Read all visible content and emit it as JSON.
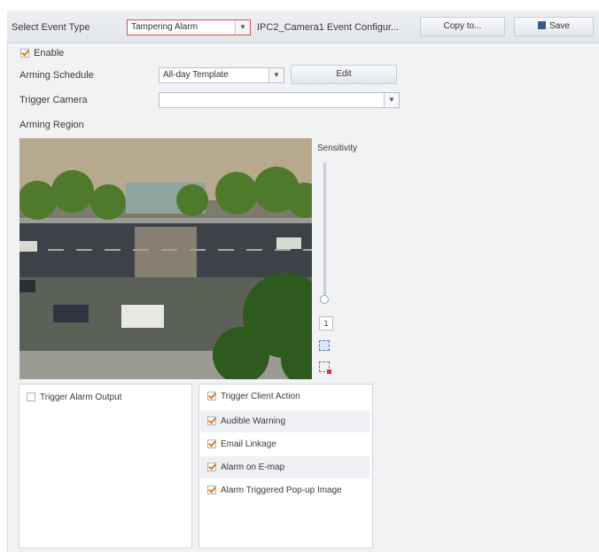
{
  "toolbar": {
    "select_event_type_label": "Select Event Type",
    "event_type_value": "Tampering Alarm",
    "camera_config_title": "IPC2_Camera1 Event Configur...",
    "copy_label": "Copy to...",
    "save_label": "Save"
  },
  "form": {
    "enable_label": "Enable",
    "enable_checked": true,
    "arming_schedule_label": "Arming Schedule",
    "arming_schedule_value": "All-day Template",
    "edit_label": "Edit",
    "trigger_camera_label": "Trigger Camera",
    "trigger_camera_value": "",
    "arming_region_label": "Arming Region"
  },
  "sensitivity": {
    "label": "Sensitivity",
    "value": "1",
    "level_fraction": 0.0
  },
  "alarm_output": {
    "label": "Trigger Alarm Output",
    "checked": false
  },
  "client_action": {
    "label": "Trigger Client Action",
    "checked": true,
    "items": [
      {
        "label": "Audible Warning",
        "checked": true
      },
      {
        "label": "Email Linkage",
        "checked": true
      },
      {
        "label": "Alarm on E-map",
        "checked": true
      },
      {
        "label": "Alarm Triggered Pop-up Image",
        "checked": true
      }
    ]
  },
  "colors": {
    "accent_check": "#e07a10",
    "selected_border": "#d65050"
  }
}
